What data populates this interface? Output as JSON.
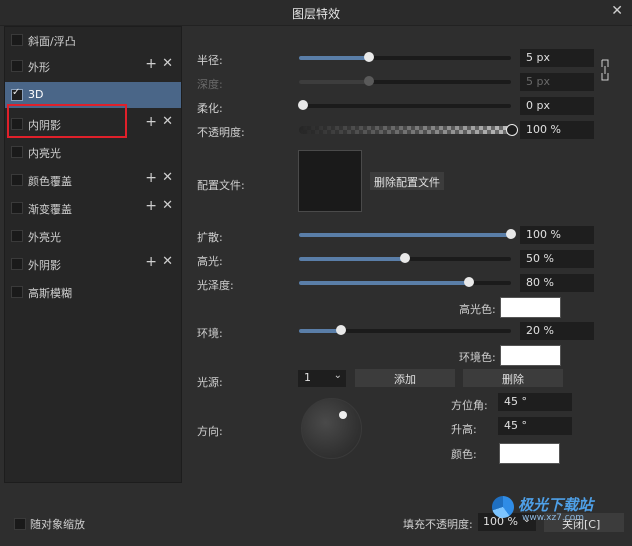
{
  "window": {
    "title": "图层特效",
    "close_glyph": "✕"
  },
  "effects": [
    {
      "label": "斜面/浮凸",
      "checked": false,
      "has_actions": false
    },
    {
      "label": "外形",
      "checked": false,
      "has_actions": true
    },
    {
      "label": "3D",
      "checked": true,
      "has_actions": false,
      "selected": true
    },
    {
      "label": "内阴影",
      "checked": false,
      "has_actions": true
    },
    {
      "label": "内亮光",
      "checked": false,
      "has_actions": false
    },
    {
      "label": "颜色覆盖",
      "checked": false,
      "has_actions": true
    },
    {
      "label": "渐变覆盖",
      "checked": false,
      "has_actions": true
    },
    {
      "label": "外亮光",
      "checked": false,
      "has_actions": false
    },
    {
      "label": "外阴影",
      "checked": false,
      "has_actions": true
    },
    {
      "label": "高斯模糊",
      "checked": false,
      "has_actions": false
    }
  ],
  "effect_actions": {
    "add_glyph": "+",
    "remove_glyph": "✕"
  },
  "params": {
    "radius": {
      "label": "半径:",
      "value": "5 px",
      "fraction": 0.33,
      "dim": false
    },
    "depth": {
      "label": "深度:",
      "value": "5 px",
      "fraction": 0.33,
      "dim": true
    },
    "soften": {
      "label": "柔化:",
      "value": "0 px",
      "fraction": 0.02,
      "dim": false
    },
    "opacity": {
      "label": "不透明度:",
      "value": "100 %",
      "fraction": 1.0,
      "dim": false
    }
  },
  "profile": {
    "label": "配置文件:",
    "delete_button": "删除配置文件"
  },
  "params2": {
    "spread": {
      "label": "扩散:",
      "value": "100 %",
      "fraction": 1.0
    },
    "highlight": {
      "label": "高光:",
      "value": "50 %",
      "fraction": 0.5
    },
    "gloss": {
      "label": "光泽度:",
      "value": "80 %",
      "fraction": 0.8
    },
    "ambient": {
      "label": "环境:",
      "value": "20 %",
      "fraction": 0.2
    }
  },
  "highlight_color": {
    "label": "高光色:",
    "color": "#ffffff"
  },
  "ambient_color": {
    "label": "环境色:",
    "color": "#ffffff"
  },
  "light_source": {
    "label": "光源:",
    "selected": "1",
    "add_button": "添加",
    "delete_button": "删除"
  },
  "direction": {
    "label": "方向:",
    "azimuth_label": "方位角:",
    "azimuth_value": "45 °",
    "elevation_label": "升高:",
    "elevation_value": "45 °",
    "color_label": "颜色:",
    "color": "#ffffff"
  },
  "footer": {
    "scale_with_object": "随对象缩放",
    "fill_opacity_label": "填充不透明度:",
    "fill_opacity_value": "100 %",
    "close_button": "关闭[C]"
  },
  "watermark": {
    "text": "极光下载站",
    "sub": "www.xz7.com"
  },
  "colors": {
    "accent": "#5a7ea8",
    "selection": "#4a6688",
    "highlight_outline": "#e0202a"
  }
}
